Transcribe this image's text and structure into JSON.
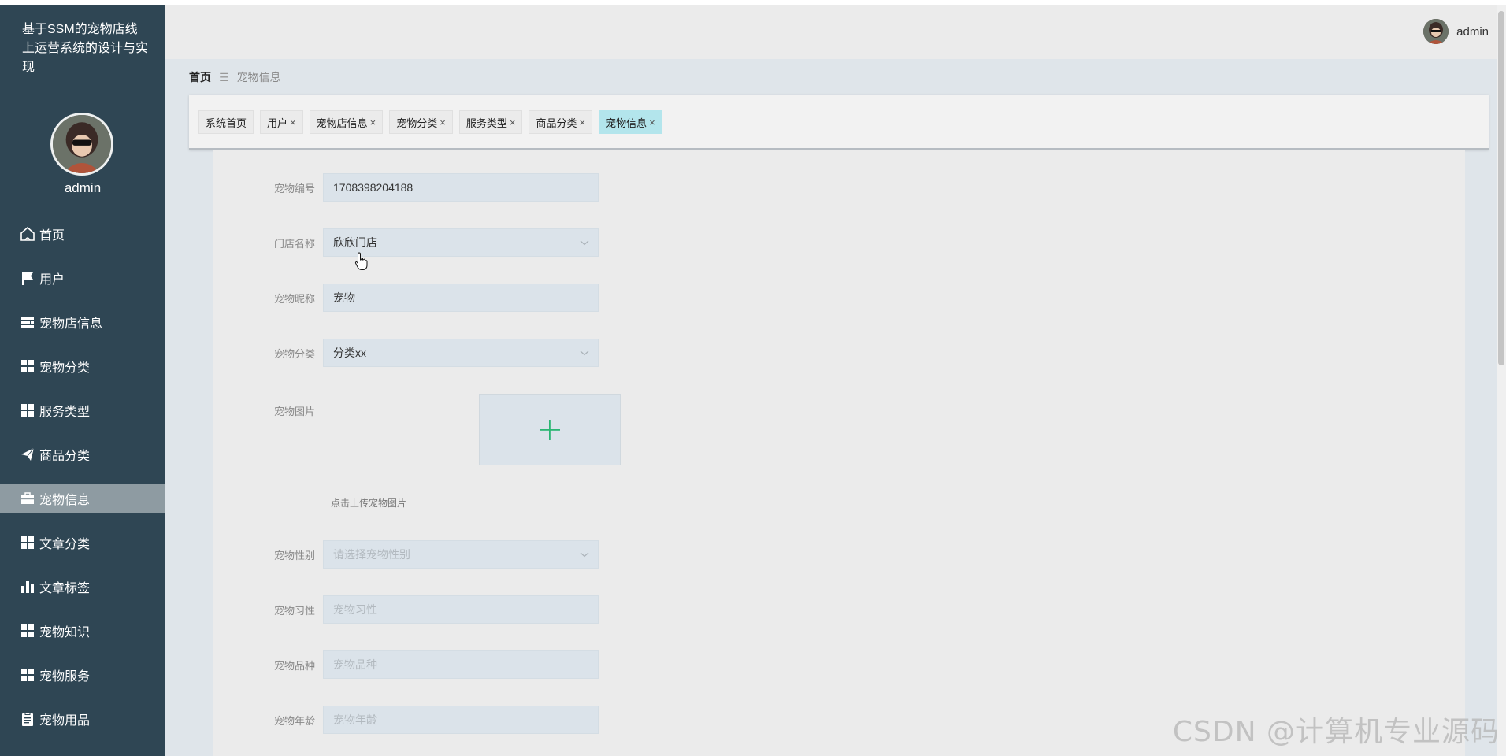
{
  "sidebar": {
    "brand": "基于SSM的宠物店线上运营系统的设计与实现",
    "username": "admin",
    "items": [
      {
        "label": "首页",
        "icon": "home-icon"
      },
      {
        "label": "用户",
        "icon": "flag-icon"
      },
      {
        "label": "宠物店信息",
        "icon": "list-icon"
      },
      {
        "label": "宠物分类",
        "icon": "grid-icon"
      },
      {
        "label": "服务类型",
        "icon": "grid-icon"
      },
      {
        "label": "商品分类",
        "icon": "paper-plane-icon"
      },
      {
        "label": "宠物信息",
        "icon": "briefcase-icon",
        "active": true
      },
      {
        "label": "文章分类",
        "icon": "grid-icon"
      },
      {
        "label": "文章标签",
        "icon": "bar-chart-icon"
      },
      {
        "label": "宠物知识",
        "icon": "grid-icon"
      },
      {
        "label": "宠物服务",
        "icon": "grid-icon"
      },
      {
        "label": "宠物用品",
        "icon": "clipboard-icon"
      }
    ]
  },
  "header": {
    "username": "admin"
  },
  "breadcrumb": {
    "home": "首页",
    "separator": "☰",
    "current": "宠物信息"
  },
  "tabs": [
    {
      "label": "系统首页",
      "closable": false
    },
    {
      "label": "用户",
      "closable": true
    },
    {
      "label": "宠物店信息",
      "closable": true
    },
    {
      "label": "宠物分类",
      "closable": true
    },
    {
      "label": "服务类型",
      "closable": true
    },
    {
      "label": "商品分类",
      "closable": true
    },
    {
      "label": "宠物信息",
      "closable": true,
      "active": true
    }
  ],
  "tab_close_glyph": "×",
  "form": {
    "pet_no": {
      "label": "宠物编号",
      "value": "1708398204188"
    },
    "store_name": {
      "label": "门店名称",
      "value": "欣欣门店"
    },
    "pet_nickname": {
      "label": "宠物昵称",
      "value": "宠物"
    },
    "pet_category": {
      "label": "宠物分类",
      "value": "分类xx"
    },
    "pet_image": {
      "label": "宠物图片",
      "tip": "点击上传宠物图片"
    },
    "pet_gender": {
      "label": "宠物性别",
      "placeholder": "请选择宠物性别"
    },
    "pet_habit": {
      "label": "宠物习性",
      "placeholder": "宠物习性"
    },
    "pet_breed": {
      "label": "宠物品种",
      "placeholder": "宠物品种"
    },
    "pet_age": {
      "label": "宠物年龄",
      "placeholder": "宠物年龄"
    }
  },
  "watermark": "CSDN @计算机专业源码",
  "colors": {
    "sidebar_bg": "#2f4654",
    "sidebar_active": "#8e9ba2",
    "tab_active": "#b3e5ec",
    "upload_plus": "#2bb673"
  }
}
